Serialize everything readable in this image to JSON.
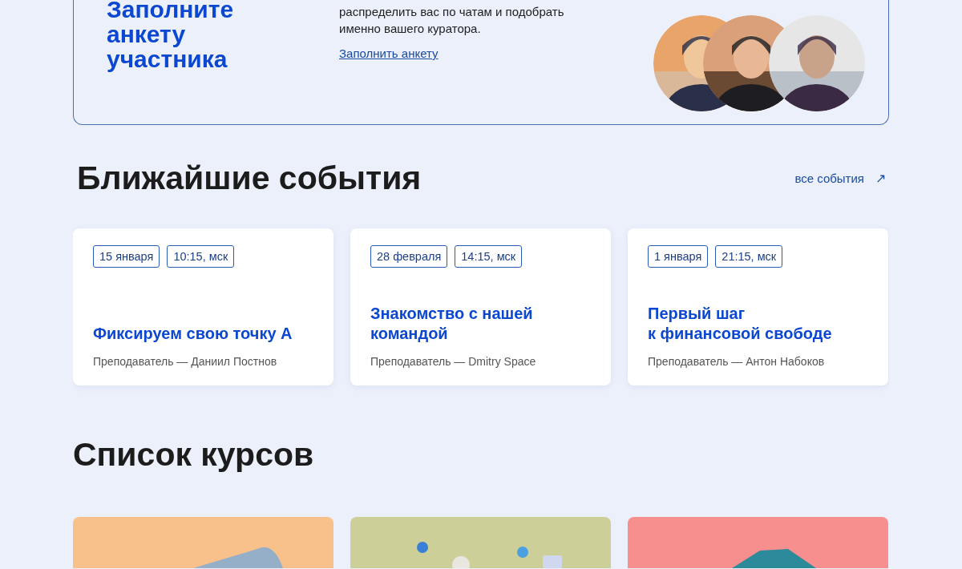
{
  "banner": {
    "title_lines": [
      "Заполните",
      "анкету",
      "участника"
    ],
    "text": "распределить вас по чатам и подобрать именно вашего куратора.",
    "link": "Заполнить анкету"
  },
  "events": {
    "title": "Ближайшие события",
    "all_link": "все события",
    "arrow": "↗",
    "items": [
      {
        "date": "15 января",
        "time": "10:15, мск",
        "title": [
          "Фиксируем свою точку А"
        ],
        "teacher": "Преподаватель — Даниил Постнов"
      },
      {
        "date": "28 февраля",
        "time": "14:15, мск",
        "title": [
          "Знакомство с нашей",
          "командой"
        ],
        "teacher": "Преподаватель — Dmitry Space"
      },
      {
        "date": "1 января",
        "time": "21:15, мск",
        "title": [
          "Первый шаг",
          "к финансовой свободе"
        ],
        "teacher": "Преподаватель — Антон Набоков"
      }
    ]
  },
  "courses": {
    "title": "Список курсов"
  }
}
